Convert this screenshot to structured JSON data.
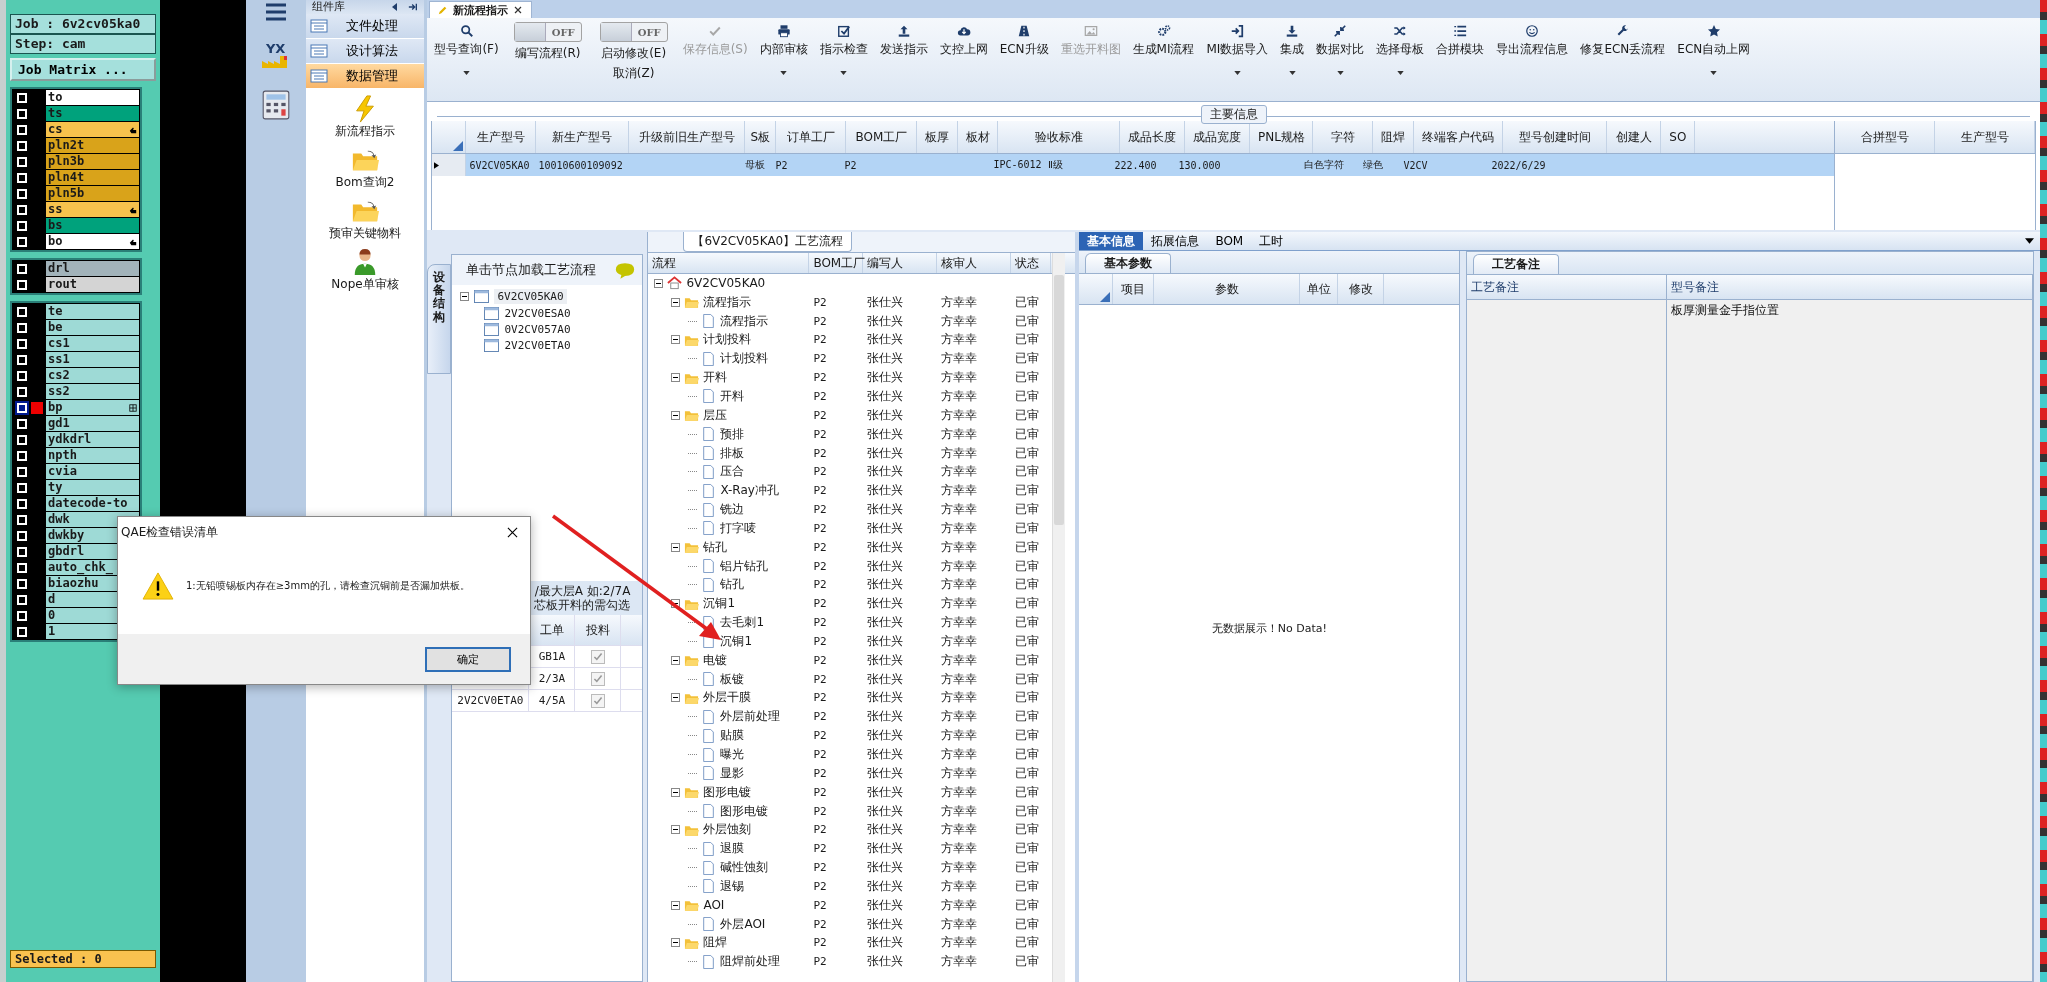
{
  "cam": {
    "job": "Job : 6v2cv05ka0",
    "step": "Step: cam",
    "matrix_button": "Job Matrix ...",
    "layer_groups": [
      {
        "layers": [
          {
            "name": "to",
            "color": "#ffffff",
            "active": false,
            "kind": "plain"
          },
          {
            "name": "ts",
            "color": "#00a27c",
            "active": false,
            "kind": "plain"
          },
          {
            "name": "cs",
            "color": "#f7c24d",
            "active": false,
            "kind": "hand"
          },
          {
            "name": "pln2t",
            "color": "#d9a31a",
            "active": false,
            "kind": "plain"
          },
          {
            "name": "pln3b",
            "color": "#d9a31a",
            "active": false,
            "kind": "plain"
          },
          {
            "name": "pln4t",
            "color": "#d9a31a",
            "active": false,
            "kind": "plain"
          },
          {
            "name": "pln5b",
            "color": "#d9a31a",
            "active": false,
            "kind": "plain"
          },
          {
            "name": "ss",
            "color": "#f7c24d",
            "active": false,
            "kind": "hand"
          },
          {
            "name": "bs",
            "color": "#00a27c",
            "active": false,
            "kind": "plain"
          },
          {
            "name": "bo",
            "color": "#ffffff",
            "active": false,
            "kind": "hand"
          }
        ]
      },
      {
        "layers": [
          {
            "name": "drl",
            "color": "#a2b3ba",
            "active": false,
            "kind": "plain"
          },
          {
            "name": "rout",
            "color": "#d4d4d4",
            "active": false,
            "kind": "plain"
          }
        ]
      },
      {
        "layers": [
          {
            "name": "te",
            "color": "#9edad6",
            "active": false,
            "kind": "plain"
          },
          {
            "name": "be",
            "color": "#9edad6",
            "active": false,
            "kind": "plain"
          },
          {
            "name": "cs1",
            "color": "#9edad6",
            "active": false,
            "kind": "plain"
          },
          {
            "name": "ss1",
            "color": "#9edad6",
            "active": false,
            "kind": "plain"
          },
          {
            "name": "cs2",
            "color": "#9edad6",
            "active": false,
            "kind": "plain"
          },
          {
            "name": "ss2",
            "color": "#9edad6",
            "active": false,
            "kind": "plain"
          },
          {
            "name": "bp",
            "color": "#9edad6",
            "active": true,
            "kind": "grid"
          },
          {
            "name": "gd1",
            "color": "#9edad6",
            "active": false,
            "kind": "plain"
          },
          {
            "name": "ydkdrl",
            "color": "#9edad6",
            "active": false,
            "kind": "plain"
          },
          {
            "name": "npth",
            "color": "#9edad6",
            "active": false,
            "kind": "plain"
          },
          {
            "name": "cvia",
            "color": "#9edad6",
            "active": false,
            "kind": "plain"
          },
          {
            "name": "ty",
            "color": "#9edad6",
            "active": false,
            "kind": "plain"
          },
          {
            "name": "datecode-to",
            "color": "#9edad6",
            "active": false,
            "kind": "plain"
          },
          {
            "name": "dwk",
            "color": "#9edad6",
            "active": false,
            "kind": "plain"
          },
          {
            "name": "dwkby",
            "color": "#9edad6",
            "active": false,
            "kind": "plain"
          },
          {
            "name": "gbdrl",
            "color": "#9edad6",
            "active": false,
            "kind": "plain"
          },
          {
            "name": "auto_chk_",
            "color": "#9edad6",
            "active": false,
            "kind": "plain"
          },
          {
            "name": "biaozhu",
            "color": "#9edad6",
            "active": false,
            "kind": "plain"
          },
          {
            "name": "d",
            "color": "#9edad6",
            "active": false,
            "kind": "plain"
          },
          {
            "name": "0",
            "color": "#9edad6",
            "active": false,
            "kind": "plain"
          },
          {
            "name": "1",
            "color": "#9edad6",
            "active": false,
            "kind": "plain"
          }
        ]
      }
    ],
    "status": "Selected : 0"
  },
  "sidebar": {
    "logo_text": "YX"
  },
  "components": {
    "title": "组件库",
    "categories": [
      {
        "label": "文件处理",
        "selected": false
      },
      {
        "label": "设计算法",
        "selected": false
      },
      {
        "label": "数据管理",
        "selected": true
      }
    ],
    "items": [
      {
        "label": "新流程指示",
        "kind": "lightning"
      },
      {
        "label": "Bom查询2",
        "kind": "folder"
      },
      {
        "label": "预审关键物料",
        "kind": "folder"
      },
      {
        "label": "Nope单审核",
        "kind": "person"
      }
    ]
  },
  "doc_tab": {
    "label": "新流程指示"
  },
  "toolbar": [
    {
      "kind": "button",
      "label": "型号查询(F)",
      "dropdown": true,
      "disabled": false
    },
    {
      "kind": "toggle",
      "switch": "OFF",
      "on": false,
      "label": "编写流程(R)"
    },
    {
      "kind": "toggle",
      "switch": "OFF",
      "on": false,
      "label": "启动修改(E)",
      "sub_label": "取消(Z)"
    },
    {
      "kind": "button",
      "label": "保存信息(S)",
      "dropdown": false,
      "disabled": true
    },
    {
      "kind": "button",
      "label": "内部审核",
      "dropdown": true,
      "disabled": false
    },
    {
      "kind": "button",
      "label": "指示检查",
      "dropdown": true,
      "disabled": false
    },
    {
      "kind": "button",
      "label": "发送指示",
      "dropdown": false,
      "disabled": false
    },
    {
      "kind": "button",
      "label": "文控上网",
      "dropdown": false,
      "disabled": false
    },
    {
      "kind": "button",
      "label": "ECN升级",
      "dropdown": false,
      "disabled": false
    },
    {
      "kind": "button",
      "label": "重选开料图",
      "dropdown": false,
      "disabled": true
    },
    {
      "kind": "button",
      "label": "生成MI流程",
      "dropdown": false,
      "disabled": false
    },
    {
      "kind": "button",
      "label": "MI数据导入",
      "dropdown": true,
      "disabled": false
    },
    {
      "kind": "button",
      "label": "集成",
      "dropdown": true,
      "disabled": false
    },
    {
      "kind": "button",
      "label": "数据对比",
      "dropdown": true,
      "disabled": false
    },
    {
      "kind": "button",
      "label": "选择母板",
      "dropdown": true,
      "disabled": false
    },
    {
      "kind": "button",
      "label": "合拼模块",
      "dropdown": false,
      "disabled": false
    },
    {
      "kind": "button",
      "label": "导出流程信息",
      "dropdown": false,
      "disabled": false
    },
    {
      "kind": "button",
      "label": "修复ECN丢流程",
      "dropdown": false,
      "disabled": false
    },
    {
      "kind": "button",
      "label": "ECN自动上网",
      "dropdown": true,
      "disabled": false
    }
  ],
  "main_info": {
    "legend": "主要信息",
    "columns": [
      "生产型号",
      "新生产型号",
      "升级前旧生产型号",
      "S板",
      "订单工厂",
      "BOM工厂",
      "板厚",
      "板材",
      "验收标准",
      "成品长度",
      "成品宽度",
      "PNL规格",
      "字符",
      "阻焊",
      "终端客户代码",
      "型号创建时间",
      "创建人",
      "SO"
    ],
    "rows": [
      {
        "selected": true,
        "cells": [
          "6V2CV05KA0",
          "10010600109092",
          null,
          "母板",
          "P2",
          "P2",
          null,
          null,
          "IPC-6012 Ⅱ级",
          "222.400",
          "130.000",
          null,
          "白色字符",
          "绿色",
          "V2CV",
          "2022/6/29",
          null,
          null
        ]
      }
    ],
    "merge_columns": [
      "合拼型号",
      "生产型号"
    ]
  },
  "structure": {
    "side_tab": "设备结构",
    "hint": "单击节点加载工艺流程",
    "tree": {
      "name": "6V2CV05KA0",
      "expanded": true,
      "children": [
        {
          "name": "2V2CV0ESA0"
        },
        {
          "name": "0V2CV057A0"
        },
        {
          "name": "2V2CV0ETA0"
        }
      ]
    },
    "note_lines": [
      "/最大层A 如:2/7A",
      "芯板开料的需勾选"
    ],
    "columns": [
      "工单",
      "投料"
    ],
    "rows": [
      {
        "order": "GB1A",
        "checked": true
      },
      {
        "order": "2/3A",
        "checked": true
      },
      {
        "code": "2V2CV0ETA0",
        "order": "4/5A",
        "checked": true
      }
    ]
  },
  "flow": {
    "tab": "【6V2CV05KA0】工艺流程",
    "columns": [
      "流程",
      "BOM工厂",
      "编写人",
      "核审人",
      "状态"
    ],
    "root": {
      "name": "6V2CV05KA0",
      "expanded": true,
      "children": [
        {
          "name": "流程指示",
          "expanded": true,
          "bom": "P2",
          "writer": "张仕兴",
          "reviewer": "方幸幸",
          "status": "已审",
          "children": [
            {
              "name": "流程指示",
              "bom": "P2",
              "writer": "张仕兴",
              "reviewer": "方幸幸",
              "status": "已审"
            }
          ]
        },
        {
          "name": "计划投料",
          "expanded": true,
          "bom": "P2",
          "writer": "张仕兴",
          "reviewer": "方幸幸",
          "status": "已审",
          "children": [
            {
              "name": "计划投料",
              "bom": "P2",
              "writer": "张仕兴",
              "reviewer": "方幸幸",
              "status": "已审"
            }
          ]
        },
        {
          "name": "开料",
          "expanded": true,
          "bom": "P2",
          "writer": "张仕兴",
          "reviewer": "方幸幸",
          "status": "已审",
          "children": [
            {
              "name": "开料",
              "bom": "P2",
              "writer": "张仕兴",
              "reviewer": "方幸幸",
              "status": "已审"
            }
          ]
        },
        {
          "name": "层压",
          "expanded": true,
          "bom": "P2",
          "writer": "张仕兴",
          "reviewer": "方幸幸",
          "status": "已审",
          "children": [
            {
              "name": "预排",
              "bom": "P2",
              "writer": "张仕兴",
              "reviewer": "方幸幸",
              "status": "已审"
            },
            {
              "name": "排板",
              "bom": "P2",
              "writer": "张仕兴",
              "reviewer": "方幸幸",
              "status": "已审"
            },
            {
              "name": "压合",
              "bom": "P2",
              "writer": "张仕兴",
              "reviewer": "方幸幸",
              "status": "已审"
            },
            {
              "name": "X-Ray冲孔",
              "bom": "P2",
              "writer": "张仕兴",
              "reviewer": "方幸幸",
              "status": "已审"
            },
            {
              "name": "铣边",
              "bom": "P2",
              "writer": "张仕兴",
              "reviewer": "方幸幸",
              "status": "已审"
            },
            {
              "name": "打字唛",
              "bom": "P2",
              "writer": "张仕兴",
              "reviewer": "方幸幸",
              "status": "已审"
            }
          ]
        },
        {
          "name": "钻孔",
          "expanded": true,
          "bom": "P2",
          "writer": "张仕兴",
          "reviewer": "方幸幸",
          "status": "已审",
          "children": [
            {
              "name": "铝片钻孔",
              "bom": "P2",
              "writer": "张仕兴",
              "reviewer": "方幸幸",
              "status": "已审"
            },
            {
              "name": "钻孔",
              "bom": "P2",
              "writer": "张仕兴",
              "reviewer": "方幸幸",
              "status": "已审"
            }
          ]
        },
        {
          "name": "沉铜1",
          "expanded": true,
          "bom": "P2",
          "writer": "张仕兴",
          "reviewer": "方幸幸",
          "status": "已审",
          "children": [
            {
              "name": "去毛刺1",
              "bom": "P2",
              "writer": "张仕兴",
              "reviewer": "方幸幸",
              "status": "已审"
            },
            {
              "name": "沉铜1",
              "bom": "P2",
              "writer": "张仕兴",
              "reviewer": "方幸幸",
              "status": "已审"
            }
          ]
        },
        {
          "name": "电镀",
          "expanded": true,
          "bom": "P2",
          "writer": "张仕兴",
          "reviewer": "方幸幸",
          "status": "已审",
          "children": [
            {
              "name": "板镀",
              "bom": "P2",
              "writer": "张仕兴",
              "reviewer": "方幸幸",
              "status": "已审"
            }
          ]
        },
        {
          "name": "外层干膜",
          "expanded": true,
          "bom": "P2",
          "writer": "张仕兴",
          "reviewer": "方幸幸",
          "status": "已审",
          "children": [
            {
              "name": "外层前处理",
              "bom": "P2",
              "writer": "张仕兴",
              "reviewer": "方幸幸",
              "status": "已审"
            },
            {
              "name": "贴膜",
              "bom": "P2",
              "writer": "张仕兴",
              "reviewer": "方幸幸",
              "status": "已审"
            },
            {
              "name": "曝光",
              "bom": "P2",
              "writer": "张仕兴",
              "reviewer": "方幸幸",
              "status": "已审"
            },
            {
              "name": "显影",
              "bom": "P2",
              "writer": "张仕兴",
              "reviewer": "方幸幸",
              "status": "已审"
            }
          ]
        },
        {
          "name": "图形电镀",
          "expanded": true,
          "bom": "P2",
          "writer": "张仕兴",
          "reviewer": "方幸幸",
          "status": "已审",
          "children": [
            {
              "name": "图形电镀",
              "bom": "P2",
              "writer": "张仕兴",
              "reviewer": "方幸幸",
              "status": "已审"
            }
          ]
        },
        {
          "name": "外层蚀刻",
          "expanded": true,
          "bom": "P2",
          "writer": "张仕兴",
          "reviewer": "方幸幸",
          "status": "已审",
          "children": [
            {
              "name": "退膜",
              "bom": "P2",
              "writer": "张仕兴",
              "reviewer": "方幸幸",
              "status": "已审"
            },
            {
              "name": "碱性蚀刻",
              "bom": "P2",
              "writer": "张仕兴",
              "reviewer": "方幸幸",
              "status": "已审"
            },
            {
              "name": "退锡",
              "bom": "P2",
              "writer": "张仕兴",
              "reviewer": "方幸幸",
              "status": "已审"
            }
          ]
        },
        {
          "name": "AOI",
          "expanded": true,
          "bom": "P2",
          "writer": "张仕兴",
          "reviewer": "方幸幸",
          "status": "已审",
          "children": [
            {
              "name": "外层AOI",
              "bom": "P2",
              "writer": "张仕兴",
              "reviewer": "方幸幸",
              "status": "已审"
            }
          ]
        },
        {
          "name": "阻焊",
          "expanded": true,
          "bom": "P2",
          "writer": "张仕兴",
          "reviewer": "方幸幸",
          "status": "已审",
          "children": [
            {
              "name": "阻焊前处理",
              "bom": "P2",
              "writer": "张仕兴",
              "reviewer": "方幸幸",
              "status": "已审"
            }
          ]
        }
      ]
    }
  },
  "details": {
    "tabs": [
      {
        "label": "基本信息",
        "selected": true
      },
      {
        "label": "拓展信息",
        "selected": false
      },
      {
        "label": "BOM",
        "selected": false
      },
      {
        "label": "工时",
        "selected": false
      }
    ],
    "params": {
      "tab": "基本参数",
      "columns": [
        "项目",
        "参数",
        "单位",
        "修改"
      ],
      "empty": "无数据展示！No Data!"
    },
    "notes": {
      "tab": "工艺备注",
      "columns": [
        "工艺备注",
        "型号备注"
      ],
      "model_note": "板厚测量金手指位置"
    }
  },
  "dialog": {
    "title": "QAE检查错误清单",
    "message": "1:无铅喷锡板内存在≥3mm的孔，请检查沉铜前是否漏加烘板。",
    "button": "确定"
  }
}
